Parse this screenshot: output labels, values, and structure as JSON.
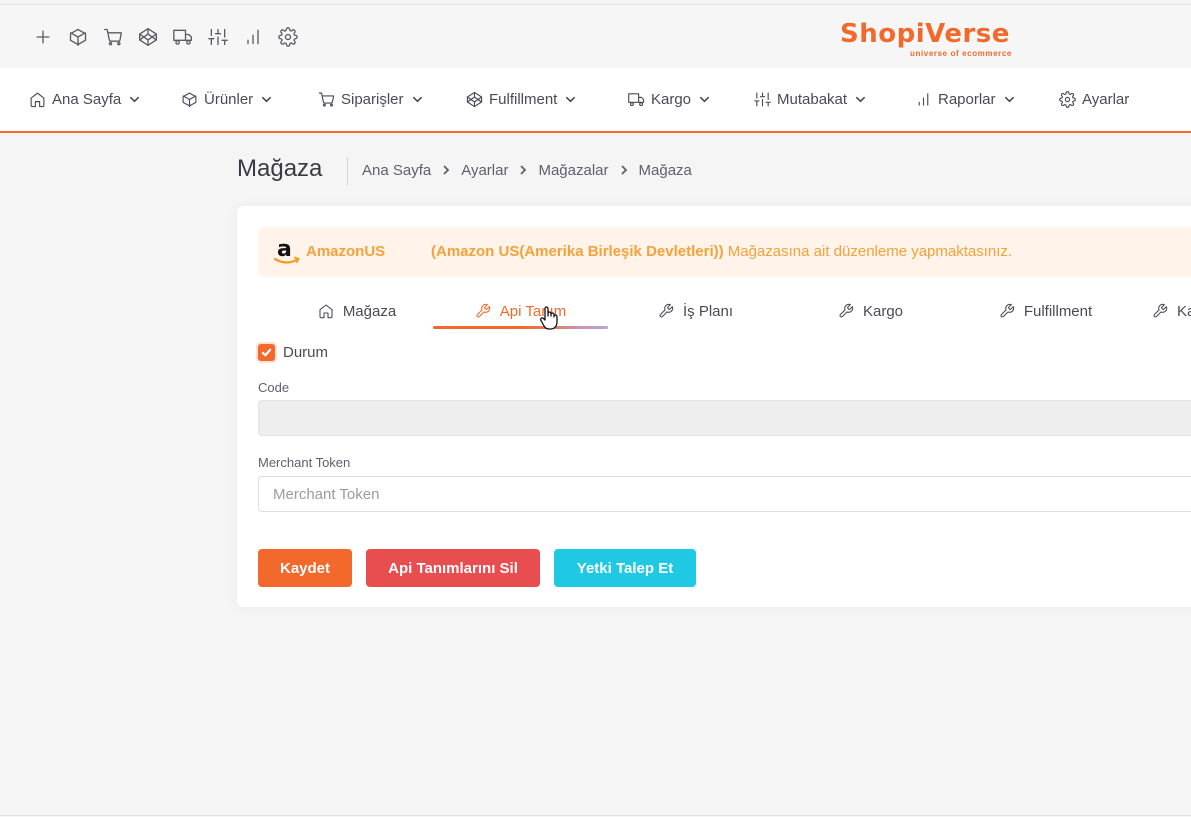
{
  "quick_icons": [
    "plus-icon",
    "box-icon",
    "cart-icon",
    "codepen-icon",
    "truck-icon",
    "sliders-icon",
    "bar-chart-icon",
    "gear-icon"
  ],
  "logo": {
    "text": "ShopiVerse",
    "tagline": "universe of ecommerce"
  },
  "nav": {
    "items": [
      {
        "label": "Ana Sayfa",
        "icon": "home-icon"
      },
      {
        "label": "Ürünler",
        "icon": "box-icon"
      },
      {
        "label": "Siparişler",
        "icon": "cart-icon"
      },
      {
        "label": "Fulfillment",
        "icon": "codepen-icon"
      },
      {
        "label": "Kargo",
        "icon": "truck-icon"
      },
      {
        "label": "Mutabakat",
        "icon": "sliders-icon"
      },
      {
        "label": "Raporlar",
        "icon": "bar-chart-icon"
      },
      {
        "label": "Ayarlar",
        "icon": "gear-icon"
      }
    ]
  },
  "page": {
    "title": "Mağaza",
    "breadcrumb": [
      "Ana Sayfa",
      "Ayarlar",
      "Mağazalar",
      "Mağaza"
    ]
  },
  "alert": {
    "store_name": "AmazonUS",
    "message_bold": "(Amazon US(Amerika Birleşik Devletleri))",
    "message_rest": " Mağazasına ait düzenleme yapmaktasınız."
  },
  "tabs": [
    {
      "label": "Mağaza",
      "icon": "home-icon"
    },
    {
      "label": "Api Tanım",
      "icon": "wrench-icon",
      "active": true
    },
    {
      "label": "İş Planı",
      "icon": "wrench-icon"
    },
    {
      "label": "Kargo",
      "icon": "wrench-icon"
    },
    {
      "label": "Fulfillment",
      "icon": "wrench-icon"
    },
    {
      "label": "Ka",
      "icon": "wrench-icon"
    }
  ],
  "form": {
    "status_label": "Durum",
    "status_checked": true,
    "code_label": "Code",
    "code_value": "",
    "merchant_label": "Merchant Token",
    "merchant_placeholder": "Merchant Token",
    "merchant_value": ""
  },
  "buttons": {
    "save": "Kaydet",
    "delete": "Api Tanımlarını Sil",
    "authorize": "Yetki Talep Et"
  },
  "colors": {
    "accent": "#f2692b",
    "danger": "#e84e4f",
    "info": "#1fc8e3",
    "warning_text": "#f4a23a",
    "warning_bg": "#fff3ea"
  }
}
